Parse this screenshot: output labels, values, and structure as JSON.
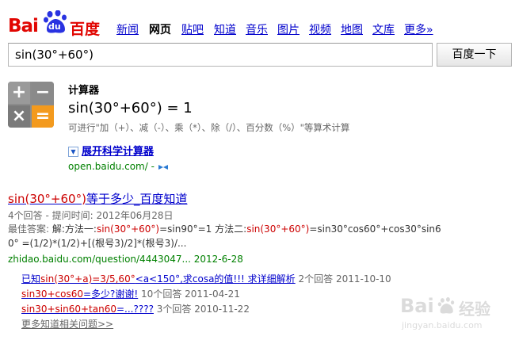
{
  "brand": {
    "logo_bai": "Bai",
    "logo_du": "du",
    "logo_cn": "百度"
  },
  "nav": [
    "新闻",
    "网页",
    "贴吧",
    "知道",
    "音乐",
    "图片",
    "视频",
    "地图",
    "文库",
    "更多»"
  ],
  "nav_current": "网页",
  "search": {
    "value": "sin(30°+60°)",
    "button": "百度一下"
  },
  "calculator": {
    "title": "计算器",
    "result": "sin(30°+60°) = 1",
    "tip": "可进行\"加（+）、减（-）、乘（*）、除（/）、百分数（%）\"等算术计算",
    "expand": "展开科学计算器",
    "url": "open.baidu.com/ -",
    "keys": [
      "+",
      "−",
      "×",
      "="
    ]
  },
  "result": {
    "title_hl": "sin(30°+60°)",
    "title_rest": "等于多少_百度知道",
    "meta": "4个回答 - 提问时间: 2012年06月28日",
    "answer_label": "最佳答案: ",
    "answer_line1_a": "解:方法一:",
    "answer_line1_b": "sin(30°+60°)",
    "answer_line1_c": "=sin90°=1 方法二:",
    "answer_line1_d": "sin(30°+60°)",
    "answer_line1_e": "=sin30°cos60°+cos30°sin6",
    "answer_line2": "0° =(1/2)*(1/2)+[(根号3)/2]*(根号3)/...",
    "url": "zhidao.baidu.com/question/4443047...  2012-6-28",
    "sub": [
      {
        "pre": "已知",
        "hl": "sin(30°+a)=3/5,60°",
        "post": "<a<150°,求cosa的值!!! 求详细解析",
        "info": " 2个回答 2011-10-10"
      },
      {
        "pre": "",
        "hl": "sin30+cos60",
        "post": "=多少?谢谢!",
        "info": " 10个回答 2011-04-21"
      },
      {
        "pre": "",
        "hl": "sin30+sin60+tan60",
        "post": "=...????",
        "info": " 3个回答 2010-11-22"
      }
    ],
    "more": "更多知道相关问题>>"
  },
  "watermark": {
    "brand": "Bai",
    "cn": "经验",
    "url": "jingyan.baidu.com"
  },
  "colors": {
    "brand_red": "#e10602",
    "link": "#0000cc",
    "url_green": "#008000",
    "highlight": "#cc0000"
  }
}
